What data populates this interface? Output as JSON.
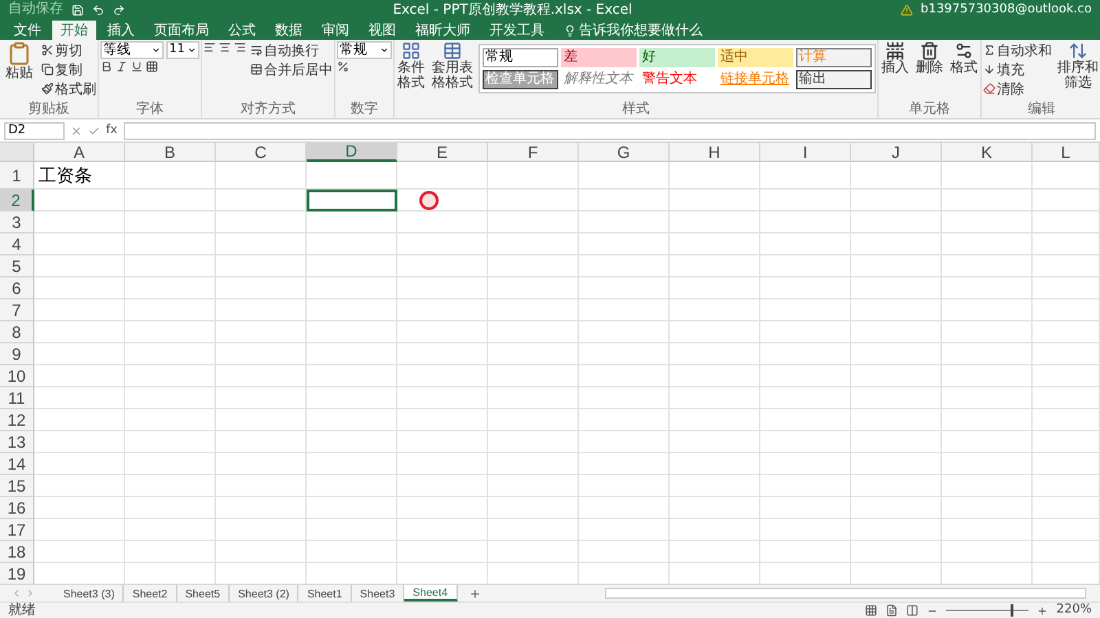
{
  "quick_access": {
    "autosave": "自动保存"
  },
  "window": {
    "title": "Excel - PPT原创教学教程.xlsx - Excel",
    "account": "b13975730308@outlook.co"
  },
  "ribbon_tabs": [
    {
      "label": "文件",
      "selected": false
    },
    {
      "label": "开始",
      "selected": true
    },
    {
      "label": "插入",
      "selected": false
    },
    {
      "label": "页面布局",
      "selected": false
    },
    {
      "label": "公式",
      "selected": false
    },
    {
      "label": "数据",
      "selected": false
    },
    {
      "label": "审阅",
      "selected": false
    },
    {
      "label": "视图",
      "selected": false
    },
    {
      "label": "福昕大师",
      "selected": false
    },
    {
      "label": "开发工具",
      "selected": false
    }
  ],
  "tell_me": "告诉我你想要做什么",
  "ribbon": {
    "clipboard": {
      "paste": "粘贴",
      "cut": "剪切",
      "copy": "复制",
      "format_painter": "格式刷",
      "label": "剪贴板"
    },
    "font": {
      "name": "等线",
      "size": "11",
      "label": "字体"
    },
    "alignment": {
      "wrap": "自动换行",
      "merge": "合并后居中",
      "label": "对齐方式"
    },
    "number": {
      "format": "常规",
      "label": "数字"
    },
    "styles": {
      "conditional": "条件格式",
      "table": "套用表格格式",
      "label": "样式",
      "gallery": [
        {
          "label": "常规",
          "kind": "normal"
        },
        {
          "label": "差",
          "kind": "bad"
        },
        {
          "label": "好",
          "kind": "good"
        },
        {
          "label": "适中",
          "kind": "neutral"
        },
        {
          "label": "计算",
          "kind": "calculation"
        },
        {
          "label": "检查单元格",
          "kind": "check"
        },
        {
          "label": "解释性文本",
          "kind": "explanatory"
        },
        {
          "label": "警告文本",
          "kind": "warning"
        },
        {
          "label": "链接单元格",
          "kind": "linked"
        },
        {
          "label": "输出",
          "kind": "output"
        }
      ]
    },
    "cells": {
      "buttons": [
        "插入",
        "删除",
        "格式"
      ],
      "label": "单元格"
    },
    "editing": {
      "autosum": "自动求和",
      "fill": "填充",
      "clear": "清除",
      "sort": "排序和筛选",
      "label": "编辑"
    }
  },
  "formula_bar": {
    "name_box": "D2",
    "function_label": "fx"
  },
  "grid": {
    "columns": [
      {
        "label": "A",
        "selected": false
      },
      {
        "label": "B",
        "selected": false
      },
      {
        "label": "C",
        "selected": false
      },
      {
        "label": "D",
        "selected": true
      },
      {
        "label": "E",
        "selected": false
      },
      {
        "label": "F",
        "selected": false
      },
      {
        "label": "G",
        "selected": false
      },
      {
        "label": "H",
        "selected": false
      },
      {
        "label": "I",
        "selected": false
      },
      {
        "label": "J",
        "selected": false
      },
      {
        "label": "K",
        "selected": false
      },
      {
        "label": "L",
        "selected": false
      }
    ],
    "rows": [
      {
        "label": "1",
        "selected": false,
        "first_cell": "工资条"
      },
      {
        "label": "2",
        "selected": true
      },
      {
        "label": "3",
        "selected": false
      },
      {
        "label": "4",
        "selected": false
      },
      {
        "label": "5",
        "selected": false
      },
      {
        "label": "6",
        "selected": false
      },
      {
        "label": "7",
        "selected": false
      },
      {
        "label": "8",
        "selected": false
      },
      {
        "label": "9",
        "selected": false
      },
      {
        "label": "10",
        "selected": false
      },
      {
        "label": "11",
        "selected": false
      },
      {
        "label": "12",
        "selected": false
      },
      {
        "label": "13",
        "selected": false
      },
      {
        "label": "14",
        "selected": false
      },
      {
        "label": "15",
        "selected": false
      },
      {
        "label": "16",
        "selected": false
      },
      {
        "label": "17",
        "selected": false
      },
      {
        "label": "18",
        "selected": false
      },
      {
        "label": "19",
        "selected": false
      }
    ]
  },
  "sheet_tabs": [
    {
      "label": "Sheet3 (3)",
      "selected": false
    },
    {
      "label": "Sheet2",
      "selected": false
    },
    {
      "label": "Sheet5",
      "selected": false
    },
    {
      "label": "Sheet3 (2)",
      "selected": false
    },
    {
      "label": "Sheet1",
      "selected": false
    },
    {
      "label": "Sheet3",
      "selected": false
    },
    {
      "label": "Sheet4",
      "selected": true
    }
  ],
  "status_bar": {
    "status": "就绪",
    "zoom": "220%",
    "zoom_slider": {
      "level": 0.78
    }
  }
}
